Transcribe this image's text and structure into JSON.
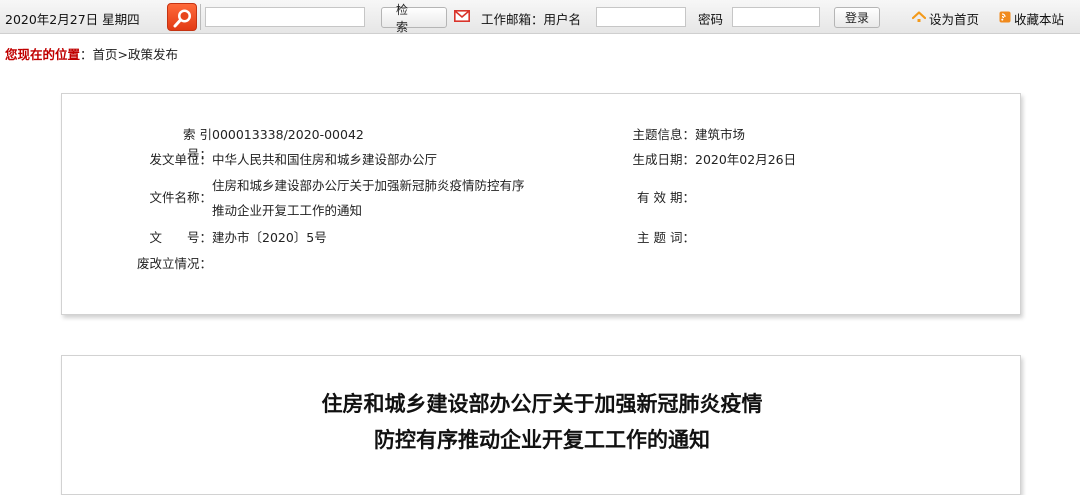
{
  "topbar": {
    "date": "2020年2月27日 星期四",
    "search_input_value": "",
    "search_button": "检索",
    "mail_label": "工作邮箱：用户名",
    "username_value": "",
    "password_label": "密码",
    "password_value": "",
    "login_button": "登录",
    "set_home": "设为首页",
    "bookmark": "收藏本站"
  },
  "breadcrumb": {
    "label": "您现在的位置",
    "colon": "：",
    "path": "首页>政策发布"
  },
  "info": {
    "index_key": "索 引 号：",
    "index_value": "000013338/2020-00042",
    "topic_key": "主题信息：",
    "topic_value": "建筑市场",
    "issuer_key": "发文单位：",
    "issuer_value": "中华人民共和国住房和城乡建设部办公厅",
    "date_key": "生成日期：",
    "date_value": "2020年02月26日",
    "filename_key": "文件名称：",
    "filename_line1": "住房和城乡建设部办公厅关于加强新冠肺炎疫情防控有序",
    "filename_line2": "推动企业开复工工作的通知",
    "validity_key": "有 效 期：",
    "validity_value": "",
    "docno_key": "文　　号：",
    "docno_value": "建办市〔2020〕5号",
    "keywords_key": "主 题 词：",
    "keywords_value": "",
    "status_key": "废改立情况：",
    "status_value": ""
  },
  "article": {
    "title_line1": "住房和城乡建设部办公厅关于加强新冠肺炎疫情",
    "title_line2": "防控有序推动企业开复工工作的通知"
  },
  "colors": {
    "accent_red": "#c00000",
    "search_orange": "#e8461c",
    "home_orange": "#f39a1b"
  }
}
